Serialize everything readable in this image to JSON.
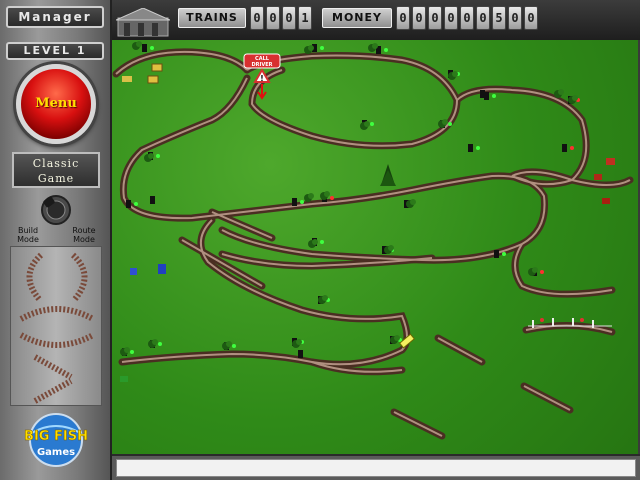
{
  "sidebar": {
    "manager_label": "Manager",
    "level_label": "LEVEL 1",
    "menu_label": "Menu",
    "game_mode_line1": "Classic",
    "game_mode_line2": "Game",
    "build_mode_label_1": "Build",
    "build_mode_label_2": "Mode",
    "route_mode_label_1": "Route",
    "route_mode_label_2": "Mode",
    "logo_text_line1": "BIG FISH",
    "logo_text_line2": "Games"
  },
  "hud": {
    "trains_label": "TRAINS",
    "trains_digits": [
      "0",
      "0",
      "0",
      "1"
    ],
    "money_label": "MONEY",
    "money_digits": [
      "0",
      "0",
      "0",
      "0",
      "0",
      "0",
      "5",
      "0",
      "0"
    ]
  },
  "map": {
    "station_sign": [
      "CALL",
      "DRIVER"
    ]
  },
  "colors": {
    "grass": "#2f8a18",
    "rail": "#8a6a5a",
    "tie": "#4a2e22",
    "menu_red": "#d81010",
    "menu_text": "#ffe000"
  }
}
